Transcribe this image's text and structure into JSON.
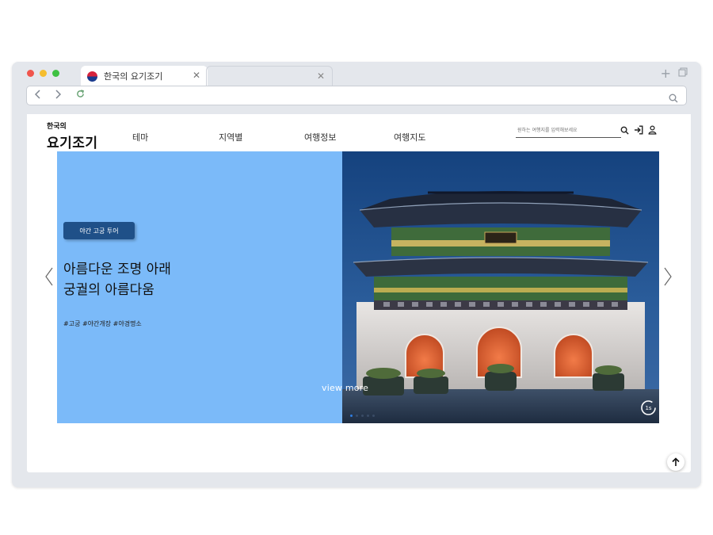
{
  "browser": {
    "tabs": [
      {
        "title": "한국의 요기조기",
        "icon": "korean-flag-icon",
        "active": true
      },
      {
        "title": "",
        "active": false
      }
    ],
    "controls": {
      "close_glyph": "✕",
      "new_tab_glyph": "+"
    }
  },
  "site": {
    "logo": {
      "small": "한국의",
      "big": "요기조기"
    },
    "nav": [
      {
        "label": "테마"
      },
      {
        "label": "지역별"
      },
      {
        "label": "여행정보"
      },
      {
        "label": "여행지도"
      }
    ],
    "search": {
      "placeholder": "원하는 여행지를 입력해보세요",
      "value": ""
    }
  },
  "hero": {
    "badge": "야간 고궁 투어",
    "headline_line1": "아름다운 조명 아래",
    "headline_line2": "궁궐의 아름다움",
    "tags": "#고궁  #야간개장  #야경명소",
    "view_more": "view more",
    "timer": "1s",
    "slide_count": 5,
    "active_slide": 0,
    "colors": {
      "panel": "#7bbaf9",
      "badge": "#1f5088",
      "night_sky": "#1e4a8a"
    }
  }
}
